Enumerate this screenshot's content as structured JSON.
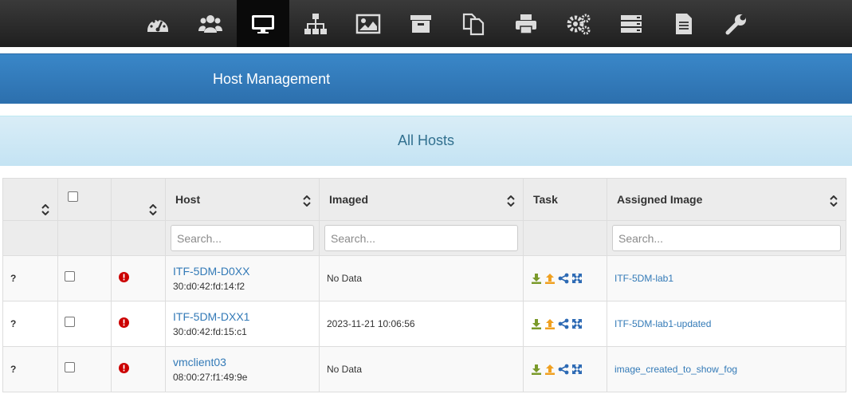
{
  "nav": {
    "items": [
      {
        "icon": "dashboard-icon"
      },
      {
        "icon": "users-icon"
      },
      {
        "icon": "hosts-icon"
      },
      {
        "icon": "groups-icon"
      },
      {
        "icon": "images-icon"
      },
      {
        "icon": "storage-icon"
      },
      {
        "icon": "snapins-icon"
      },
      {
        "icon": "printers-icon"
      },
      {
        "icon": "settings-icon"
      },
      {
        "icon": "tasks-icon"
      },
      {
        "icon": "reports-icon"
      },
      {
        "icon": "plugins-icon"
      }
    ],
    "active_index": 2
  },
  "page": {
    "title": "Host Management",
    "subtitle": "All Hosts"
  },
  "table": {
    "columns": [
      "",
      "",
      "",
      "Host",
      "Imaged",
      "Task",
      "Assigned Image"
    ],
    "search_placeholder": "Search...",
    "rows": [
      {
        "status": "?",
        "host": "ITF-5DM-D0XX",
        "mac": "30:d0:42:fd:14:f2",
        "imaged": "No Data",
        "image": "ITF-5DM-lab1"
      },
      {
        "status": "?",
        "host": "ITF-5DM-DXX1",
        "mac": "30:d0:42:fd:15:c1",
        "imaged": "2023-11-21 10:06:56",
        "image": "ITF-5DM-lab1-updated"
      },
      {
        "status": "?",
        "host": "vmclient03",
        "mac": "08:00:27:f1:49:9e",
        "imaged": "No Data",
        "image": "image_created_to_show_fog"
      }
    ]
  },
  "colors": {
    "nav_bg": "#2b2b2b",
    "banner": "#3478bd",
    "subbanner": "#d9edf7",
    "link": "#337ab7",
    "error": "#cc0000",
    "deploy": "#7a9a2a",
    "capture": "#f0a020"
  }
}
